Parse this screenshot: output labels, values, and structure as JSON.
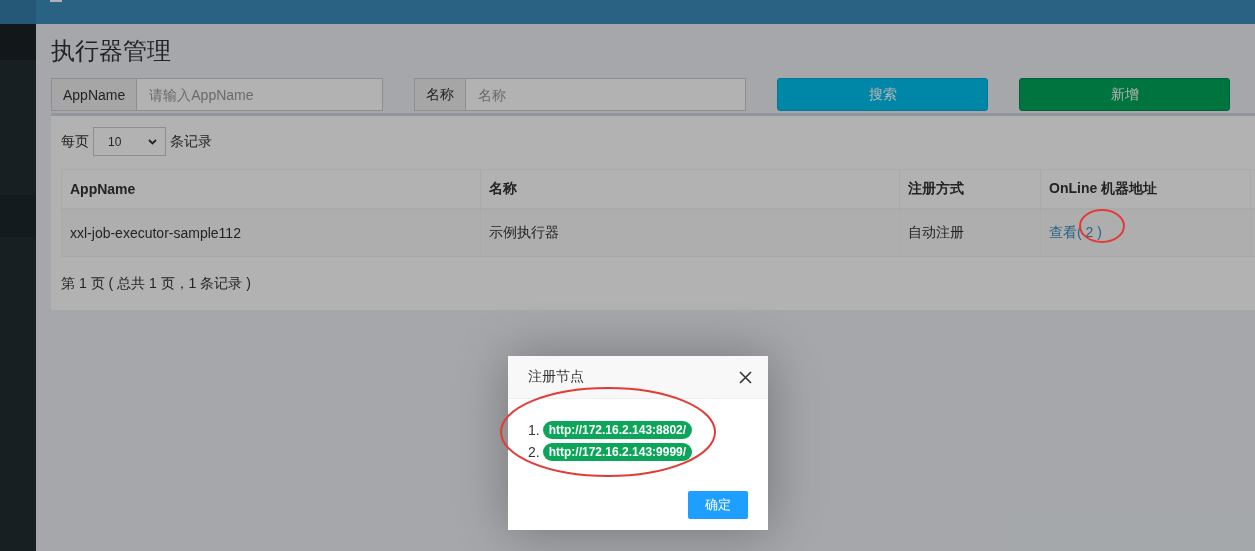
{
  "title": "执行器管理",
  "filters": [
    {
      "label": "AppName",
      "placeholder": "请输入AppName"
    },
    {
      "label": "名称",
      "placeholder": "名称"
    }
  ],
  "buttons": [
    {
      "kind": "search",
      "label": "搜索"
    },
    {
      "kind": "add",
      "label": "新增"
    }
  ],
  "page_size": {
    "prefix": "每页",
    "value": "10",
    "suffix": "条记录"
  },
  "table": {
    "columns": [
      "AppName",
      "名称",
      "注册方式",
      "OnLine 机器地址"
    ],
    "rows": [
      {
        "cells": [
          "xxl-job-executor-sample112",
          "示例执行器",
          "自动注册"
        ],
        "link": "查看",
        "count": "( 2 )"
      }
    ]
  },
  "pagination": "第 1 页 ( 总共 1 页，1 条记录 )",
  "dialog": {
    "title": "注册节点",
    "items": [
      {
        "marker": "1.",
        "address": "http://172.16.2.143:8802/"
      },
      {
        "marker": "2.",
        "address": "http://172.16.2.143:9999/"
      }
    ],
    "ok": "确定"
  }
}
